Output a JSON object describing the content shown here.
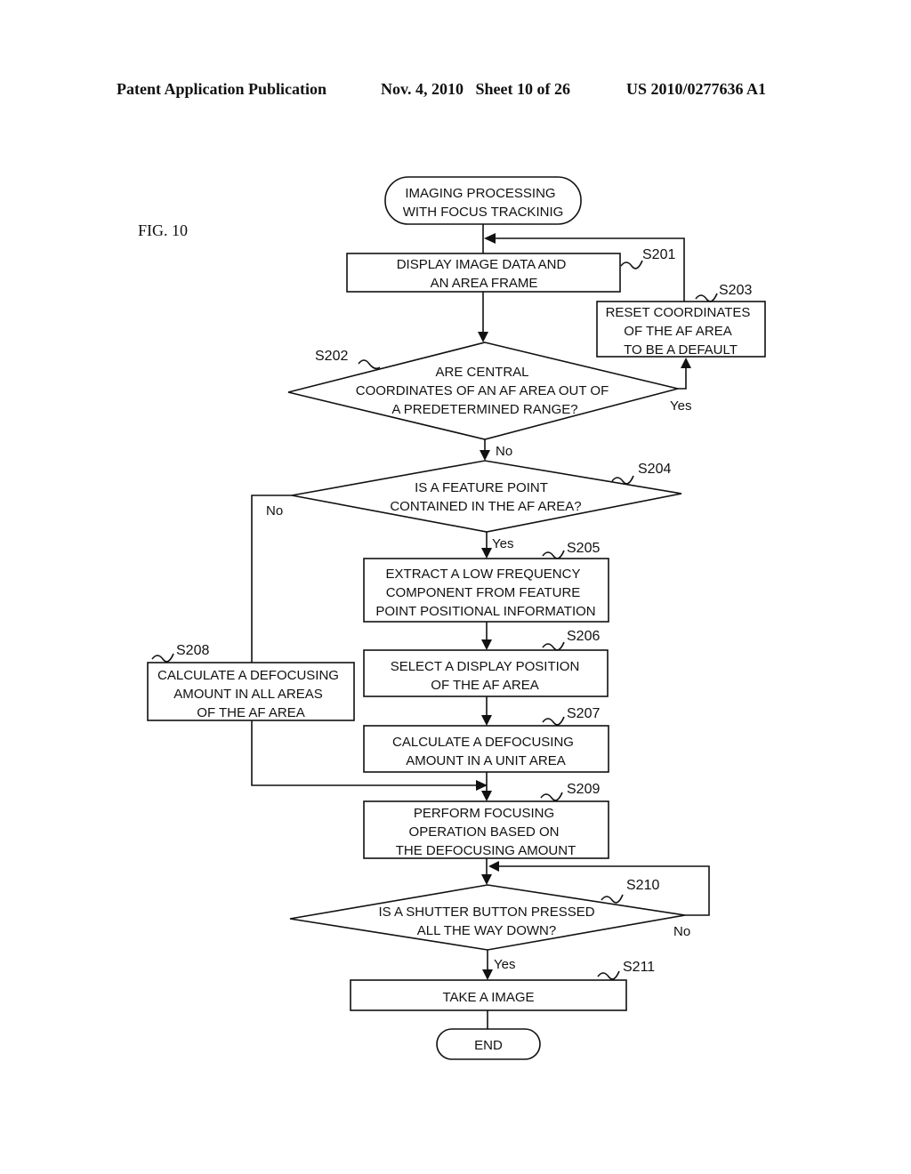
{
  "header": {
    "left": "Patent Application Publication",
    "date_sheet": "Nov. 4, 2010   Sheet 10 of 26",
    "pub_number": "US 2010/0277636 A1"
  },
  "figure_label": "FIG. 10",
  "flowchart": {
    "start": [
      "IMAGING PROCESSING",
      "WITH FOCUS TRACKINIG"
    ],
    "steps": {
      "S201": {
        "label": "S201",
        "lines": [
          "DISPLAY IMAGE DATA AND",
          "AN AREA FRAME"
        ]
      },
      "S202": {
        "label": "S202",
        "lines": [
          "ARE CENTRAL",
          "COORDINATES OF AN AF AREA OUT OF",
          "A PREDETERMINED RANGE?"
        ]
      },
      "S203": {
        "label": "S203",
        "lines": [
          "RESET COORDINATES",
          "OF THE AF AREA",
          "TO BE A DEFAULT"
        ]
      },
      "S204": {
        "label": "S204",
        "lines": [
          "IS A FEATURE POINT",
          "CONTAINED IN THE AF AREA?"
        ]
      },
      "S205": {
        "label": "S205",
        "lines": [
          "EXTRACT A LOW FREQUENCY",
          "COMPONENT FROM FEATURE",
          "POINT POSITIONAL INFORMATION"
        ]
      },
      "S206": {
        "label": "S206",
        "lines": [
          "SELECT A DISPLAY POSITION",
          "OF THE AF AREA"
        ]
      },
      "S207": {
        "label": "S207",
        "lines": [
          "CALCULATE A DEFOCUSING",
          "AMOUNT IN A UNIT AREA"
        ]
      },
      "S208": {
        "label": "S208",
        "lines": [
          "CALCULATE A DEFOCUSING",
          "AMOUNT IN ALL AREAS",
          "OF THE AF AREA"
        ]
      },
      "S209": {
        "label": "S209",
        "lines": [
          "PERFORM FOCUSING",
          "OPERATION BASED ON",
          "THE DEFOCUSING AMOUNT"
        ]
      },
      "S210": {
        "label": "S210",
        "lines": [
          "IS A SHUTTER BUTTON PRESSED",
          "ALL THE WAY DOWN?"
        ]
      },
      "S211": {
        "label": "S211",
        "lines": [
          "TAKE A IMAGE"
        ]
      }
    },
    "end": "END",
    "branches": {
      "s202_yes": "Yes",
      "s202_no": "No",
      "s204_no": "No",
      "s204_yes": "Yes",
      "s210_no": "No",
      "s210_yes": "Yes"
    }
  }
}
